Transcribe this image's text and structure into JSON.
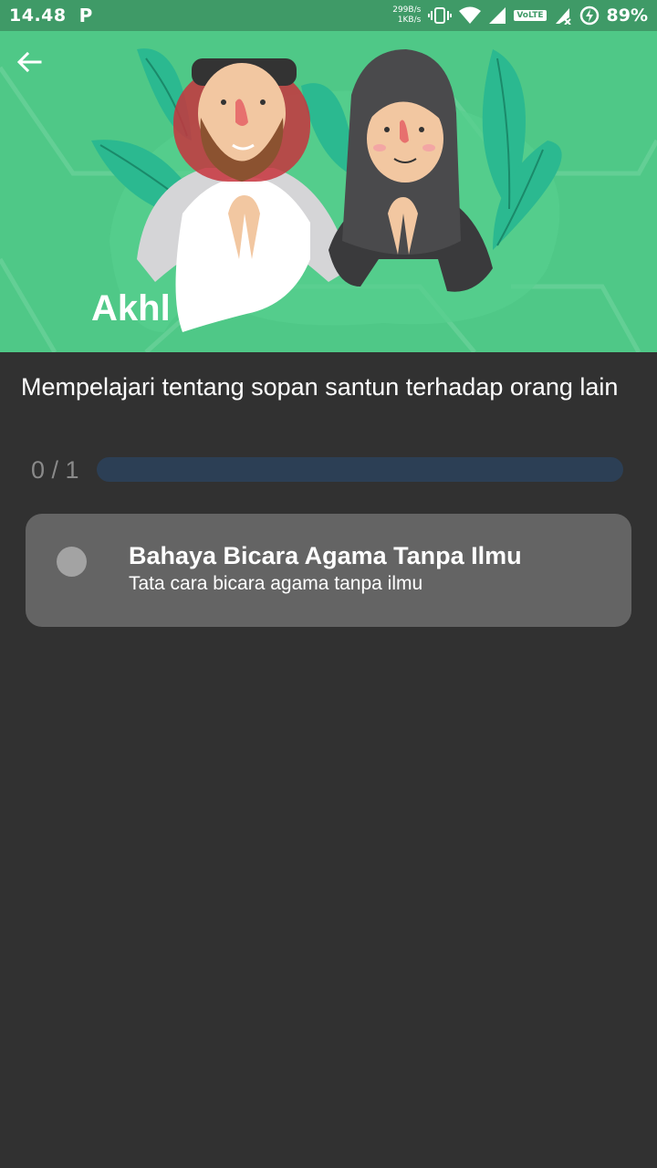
{
  "status_bar": {
    "time": "14.48",
    "app_indicator": "P",
    "net_speed_up": "299B/s",
    "net_speed_down": "1KB/s",
    "volte": "VoLTE",
    "battery": "89%",
    "icons": [
      "vibrate-icon",
      "wifi-icon",
      "signal-icon",
      "signal-no-data-icon",
      "data-saver-icon"
    ]
  },
  "header": {
    "back_icon": "arrow-left-icon",
    "title": "Akhl"
  },
  "course": {
    "description": "Mempelajari tentang sopan santun terhadap orang lain",
    "progress_text": "0 / 1",
    "progress_fraction": 0.0
  },
  "lessons": [
    {
      "title": "Bahaya Bicara Agama Tanpa Ilmu",
      "subtitle": "Tata cara bicara agama tanpa ilmu",
      "status_icon": "incomplete-dot-icon"
    }
  ],
  "colors": {
    "hero_green": "#4fc887",
    "status_green": "#3f9a67",
    "background": "#313131",
    "progress_track": "#2c3f55",
    "card": "#646464"
  }
}
